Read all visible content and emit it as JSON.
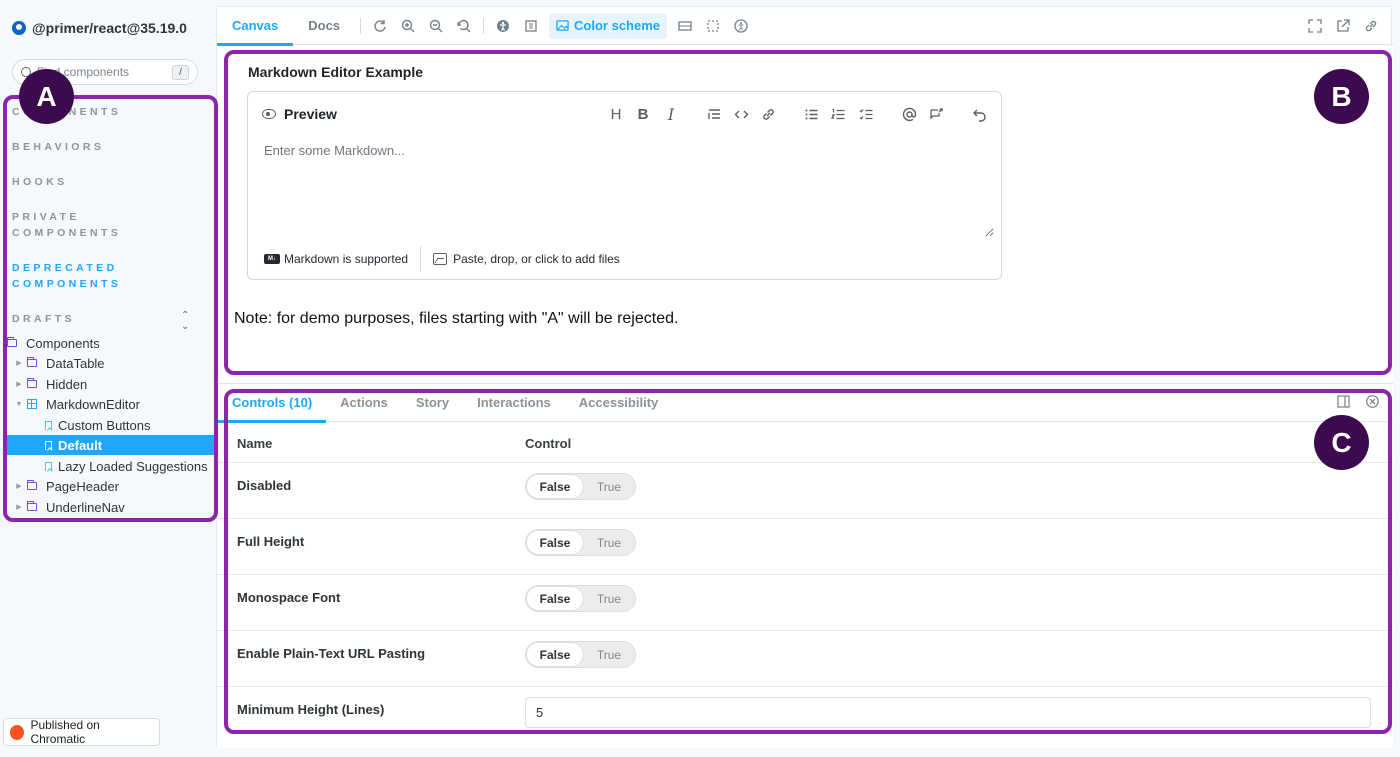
{
  "sidebar": {
    "brand": "@primer/react@35.19.0",
    "search_placeholder": "Find components",
    "search_shortcut": "/",
    "sections": [
      {
        "label": "COMPONENTS",
        "label2": ""
      },
      {
        "label": "BEHAVIORS",
        "label2": ""
      },
      {
        "label": "HOOKS",
        "label2": ""
      },
      {
        "label": "PRIVATE",
        "label2": "COMPONENTS"
      },
      {
        "label": "DEPRECATED",
        "label2": "COMPONENTS"
      },
      {
        "label": "DRAFTS",
        "label2": ""
      }
    ],
    "tree": [
      {
        "label": "Components"
      },
      {
        "label": "DataTable"
      },
      {
        "label": "Hidden"
      },
      {
        "label": "MarkdownEditor"
      },
      {
        "label": "Custom Buttons"
      },
      {
        "label": "Default"
      },
      {
        "label": "Lazy Loaded Suggestions"
      },
      {
        "label": "PageHeader"
      },
      {
        "label": "UnderlineNav"
      }
    ],
    "chromatic_label": "Published on Chromatic"
  },
  "toolbar": {
    "tabs": [
      {
        "label": "Canvas"
      },
      {
        "label": "Docs"
      }
    ],
    "color_scheme_label": "Color scheme"
  },
  "canvas": {
    "example_title": "Markdown Editor Example",
    "preview_label": "Preview",
    "editor_placeholder": "Enter some Markdown...",
    "markdown_supported": "Markdown is supported",
    "md_badge": "M↓",
    "attach_label": "Paste, drop, or click to add files",
    "note": "Note: for demo purposes, files starting with \"A\" will be rejected."
  },
  "panel": {
    "tabs": [
      {
        "label": "Controls (10)"
      },
      {
        "label": "Actions"
      },
      {
        "label": "Story"
      },
      {
        "label": "Interactions"
      },
      {
        "label": "Accessibility"
      }
    ],
    "headers": {
      "name": "Name",
      "control": "Control"
    },
    "rows": [
      {
        "name": "Disabled",
        "false_label": "False",
        "true_label": "True"
      },
      {
        "name": "Full Height",
        "false_label": "False",
        "true_label": "True"
      },
      {
        "name": "Monospace Font",
        "false_label": "False",
        "true_label": "True"
      },
      {
        "name": "Enable Plain-Text URL Pasting",
        "false_label": "False",
        "true_label": "True"
      }
    ],
    "min_height": {
      "name": "Minimum Height (Lines)",
      "value": "5"
    }
  },
  "annotations": {
    "a": "A",
    "b": "B",
    "c": "C"
  },
  "colors": {
    "accent": "#1ea7fd",
    "annotation": "#8e24aa",
    "badge": "#3d0a4f"
  }
}
